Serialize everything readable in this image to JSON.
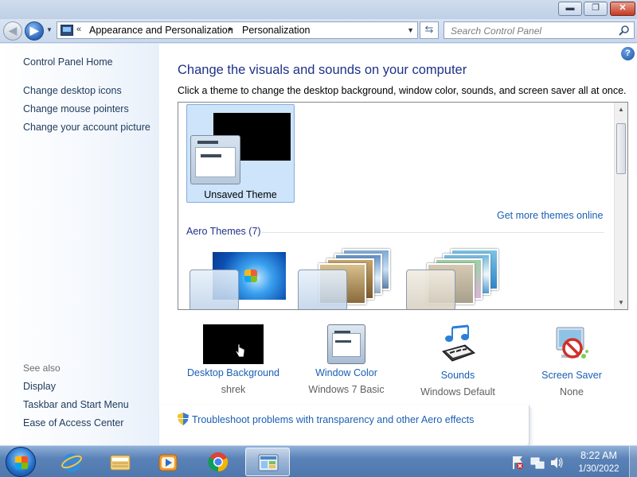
{
  "window": {
    "minimize_label": "▬",
    "maximize_label": "❐",
    "close_label": "✕"
  },
  "navbar": {
    "breadcrumb_chevron": "«",
    "breadcrumb": [
      "Appearance and Personalization",
      "Personalization"
    ],
    "breadcrumb_separator": "▸",
    "search_placeholder": "Search Control Panel"
  },
  "sidebar": {
    "home": "Control Panel Home",
    "links": [
      "Change desktop icons",
      "Change mouse pointers",
      "Change your account picture"
    ],
    "see_also_heading": "See also",
    "see_also": [
      "Display",
      "Taskbar and Start Menu",
      "Ease of Access Center"
    ]
  },
  "main": {
    "help_label": "?",
    "heading": "Change the visuals and sounds on your computer",
    "subheading": "Click a theme to change the desktop background, window color, sounds, and screen saver all at once.",
    "selected_theme": "Unsaved Theme",
    "more_themes_link": "Get more themes online",
    "aero_group_label": "Aero Themes (7)"
  },
  "settings": [
    {
      "link": "Desktop Background",
      "value": "shrek"
    },
    {
      "link": "Window Color",
      "value": "Windows 7 Basic"
    },
    {
      "link": "Sounds",
      "value": "Windows Default"
    },
    {
      "link": "Screen Saver",
      "value": "None"
    }
  ],
  "troubleshoot_link": "Troubleshoot problems with transparency and other Aero effects",
  "taskbar": {
    "time": "8:22 AM",
    "date": "1/30/2022",
    "apps": [
      "internet-explorer",
      "windows-explorer",
      "windows-media-player",
      "google-chrome",
      "control-panel"
    ]
  },
  "colors": {
    "link": "#1a5fb4",
    "heading": "#1e3287",
    "selection": "#cde4fb",
    "taskbar": "#5a82b7"
  }
}
